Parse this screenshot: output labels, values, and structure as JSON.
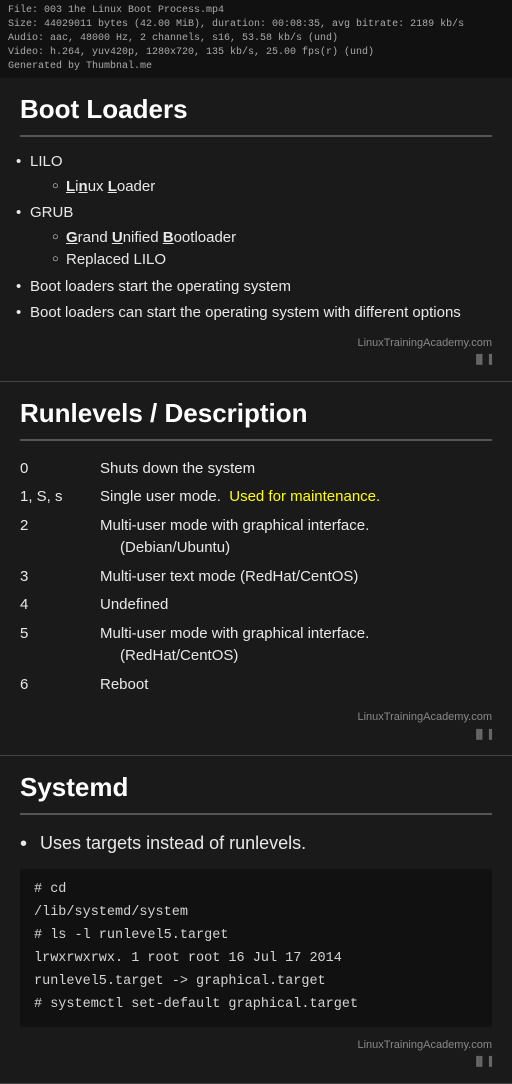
{
  "file_info": {
    "line1": "File: 003 1he Linux Boot Process.mp4",
    "line2": "Size: 44029011 bytes (42.00 MiB), duration: 00:08:35, avg bitrate: 2189 kb/s",
    "line3": "Audio: aac, 48000 Hz, 2 channels, s16, 53.58 kb/s (und)",
    "line4": "Video: h.264, yuv420p, 1280x720, 135 kb/s, 25.00 fps(r) (und)",
    "line5": "Generated by Thumbnal.me"
  },
  "sections": {
    "boot_loaders": {
      "title": "Boot Loaders",
      "items": [
        {
          "text": "LILO",
          "sub": [
            {
              "bold": "L",
              "rest_bold": "i",
              "plain": "nux ",
              "bold2": "L",
              "rest": "oader",
              "full": "Linux Loader"
            }
          ]
        },
        {
          "text": "GRUB",
          "sub": [
            {
              "full": "Grand Unified Bootloader"
            },
            {
              "full": "Replaced LILO"
            }
          ]
        },
        {
          "text": "Boot loaders start the operating system"
        },
        {
          "text": "Boot loaders can start the operating system with different options"
        }
      ],
      "watermark": "LinuxTrainingAcademy.com"
    },
    "runlevels": {
      "title": "Runlevels  / Description",
      "rows": [
        {
          "level": "0",
          "desc": "Shuts down the system"
        },
        {
          "level": "1, S, s",
          "desc": "Single user mode.  Used for maintenance."
        },
        {
          "level": "2",
          "desc": "Multi-user mode with graphical interface.\n(Debian/Ubuntu)"
        },
        {
          "level": "3",
          "desc": "Multi-user text mode (RedHat/CentOS)"
        },
        {
          "level": "4",
          "desc": "Undefined"
        },
        {
          "level": "5",
          "desc": "Multi-user mode with graphical interface.\n(RedHat/CentOS)"
        },
        {
          "level": "6",
          "desc": "Reboot"
        }
      ],
      "watermark": "LinuxTrainingAcademy.com"
    },
    "systemd": {
      "title": "Systemd",
      "bullet": "Uses targets instead of runlevels.",
      "code_lines": [
        "# cd",
        "/lib/systemd/system",
        "# ls -l runlevel5.target",
        "lrwxrwxrwx. 1 root root  16 Jul 17  2014",
        "runlevel5.target -> graphical.target",
        "# systemctl set-default graphical.target"
      ],
      "watermark": "LinuxTrainingAcademy.com"
    }
  }
}
